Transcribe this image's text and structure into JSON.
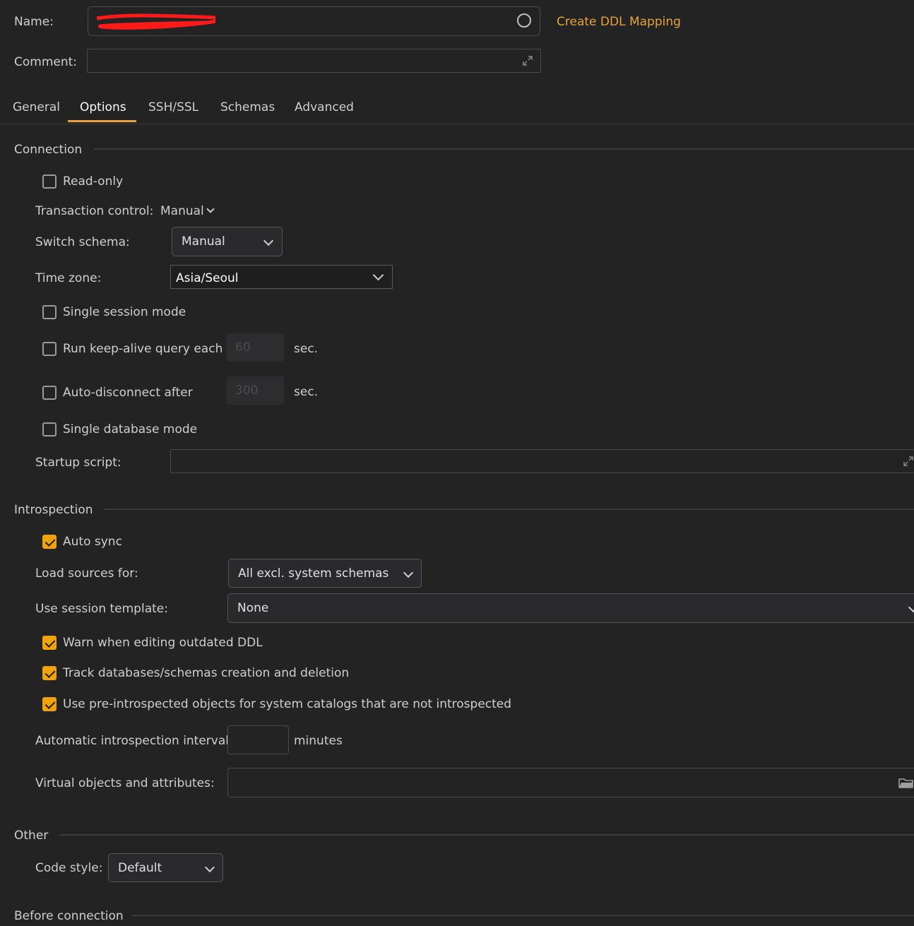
{
  "header": {
    "name_label": "Name:",
    "comment_label": "Comment:",
    "create_ddl_label": "Create DDL Mapping"
  },
  "tabs": [
    {
      "label": "General"
    },
    {
      "label": "Options"
    },
    {
      "label": "SSH/SSL"
    },
    {
      "label": "Schemas"
    },
    {
      "label": "Advanced"
    }
  ],
  "active_tab": "Options",
  "connection": {
    "section_title": "Connection",
    "read_only_label": "Read-only",
    "read_only_checked": false,
    "transaction_label": "Transaction control:",
    "transaction_value": "Manual",
    "switch_schema_label": "Switch schema:",
    "switch_schema_value": "Manual",
    "timezone_label": "Time zone:",
    "timezone_value": "Asia/Seoul",
    "single_session_label": "Single session mode",
    "single_session_checked": false,
    "keepalive_label": "Run keep-alive query each",
    "keepalive_checked": false,
    "keepalive_value": "60",
    "keepalive_unit": "sec.",
    "autodisconnect_label": "Auto-disconnect after",
    "autodisconnect_checked": false,
    "autodisconnect_value": "300",
    "autodisconnect_unit": "sec.",
    "single_db_label": "Single database mode",
    "single_db_checked": false,
    "startup_label": "Startup script:"
  },
  "introspection": {
    "section_title": "Introspection",
    "auto_sync_label": "Auto sync",
    "auto_sync_checked": true,
    "load_sources_label": "Load sources for:",
    "load_sources_value": "All excl. system schemas",
    "session_template_label": "Use session template:",
    "session_template_value": "None",
    "warn_outdated_label": "Warn when editing outdated DDL",
    "warn_outdated_checked": true,
    "track_label": "Track databases/schemas creation and deletion",
    "track_checked": true,
    "preintrospected_label": "Use pre-introspected objects for system catalogs that are not introspected",
    "preintrospected_checked": true,
    "interval_label": "Automatic introspection interval",
    "interval_unit": "minutes",
    "virtual_label": "Virtual objects and attributes:"
  },
  "other": {
    "section_title": "Other",
    "code_style_label": "Code style:",
    "code_style_value": "Default"
  },
  "before_connection": {
    "section_title": "Before connection"
  },
  "colors": {
    "accent": "#e8a33c",
    "checkbox_checked": "#f0a30a",
    "background": "#232324"
  }
}
